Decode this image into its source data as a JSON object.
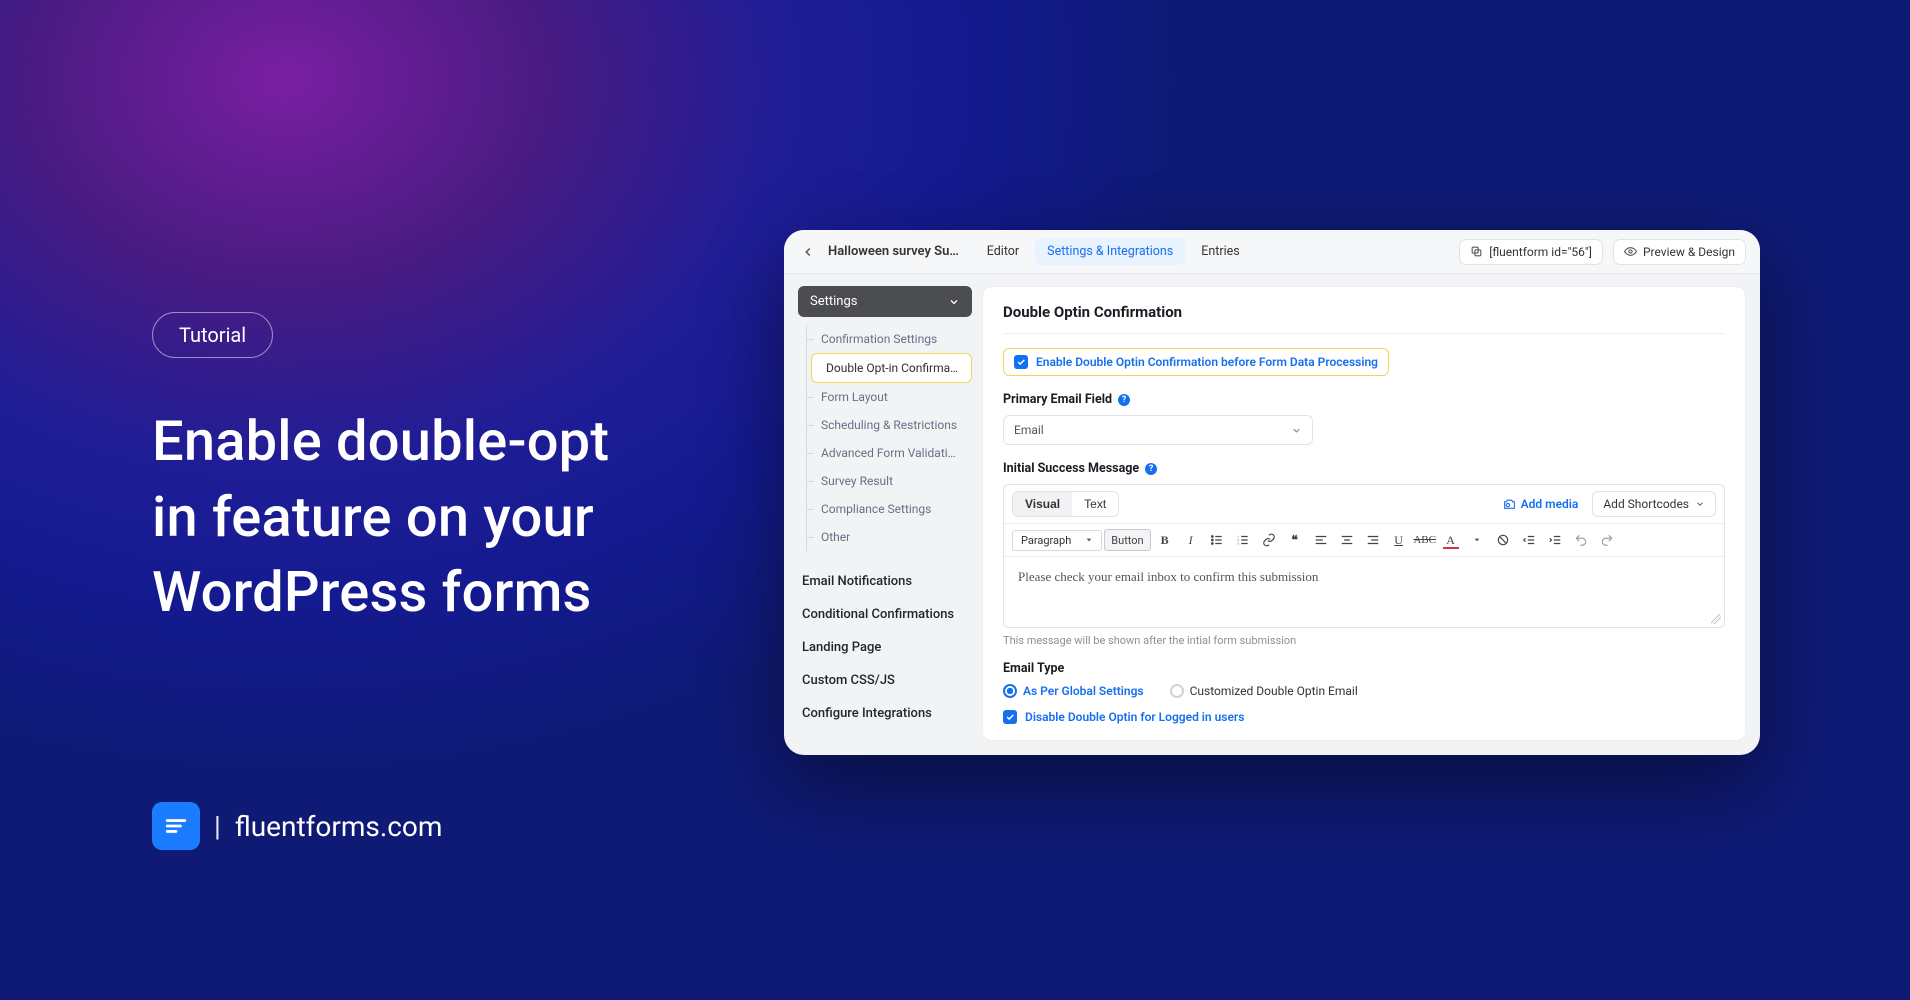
{
  "promo": {
    "badge": "Tutorial",
    "headline_l1": "Enable double-opt",
    "headline_l2": "in feature on your",
    "headline_l3": "WordPress forms",
    "brand": "fluentforms.com"
  },
  "topbar": {
    "title": "Halloween survey Su…",
    "tabs": {
      "editor": "Editor",
      "settings": "Settings & Integrations",
      "entries": "Entries"
    },
    "shortcode": "[fluentform id=\"56\"]",
    "preview": "Preview & Design"
  },
  "sidebar": {
    "group": "Settings",
    "items": [
      "Confirmation Settings",
      "Double Opt-in Confirma…",
      "Form Layout",
      "Scheduling & Restrictions",
      "Advanced Form Validati…",
      "Survey Result",
      "Compliance Settings",
      "Other"
    ],
    "links": [
      "Email Notifications",
      "Conditional Confirmations",
      "Landing Page",
      "Custom CSS/JS",
      "Configure Integrations"
    ]
  },
  "panel": {
    "heading": "Double Optin Confirmation",
    "enable_label": "Enable Double Optin Confirmation before Form Data Processing",
    "primary_label": "Primary Email Field",
    "primary_value": "Email",
    "success_label": "Initial Success Message",
    "tabs": {
      "visual": "Visual",
      "text": "Text"
    },
    "add_media": "Add media",
    "add_shortcodes": "Add Shortcodes",
    "paragraph": "Paragraph",
    "button_tool": "Button",
    "editor_text": "Please check your email inbox to confirm this submission",
    "helper": "This message will be shown after the intial form submission",
    "email_type_label": "Email Type",
    "radios": {
      "global": "As Per Global Settings",
      "custom": "Customized Double Optin Email"
    },
    "disable_logged": "Disable Double Optin for Logged in users"
  }
}
